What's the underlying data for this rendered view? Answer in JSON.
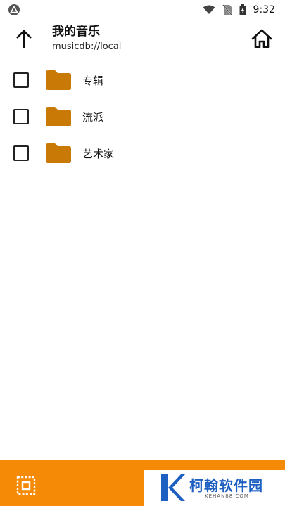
{
  "status_bar": {
    "time": "9:32",
    "icons": [
      "app-logo-icon",
      "wifi-icon",
      "no-sim-icon",
      "battery-icon"
    ]
  },
  "header": {
    "title": "我的音乐",
    "subtitle": "musicdb://local"
  },
  "items": [
    {
      "label": "专辑"
    },
    {
      "label": "流派"
    },
    {
      "label": "艺术家"
    }
  ],
  "colors": {
    "folder": "#c97a06",
    "bottom_bar": "#f58a07",
    "watermark_text": "#1e5fc2"
  },
  "watermark": {
    "title": "柯翰软件园",
    "subtitle": "KEHAN88.COM"
  }
}
